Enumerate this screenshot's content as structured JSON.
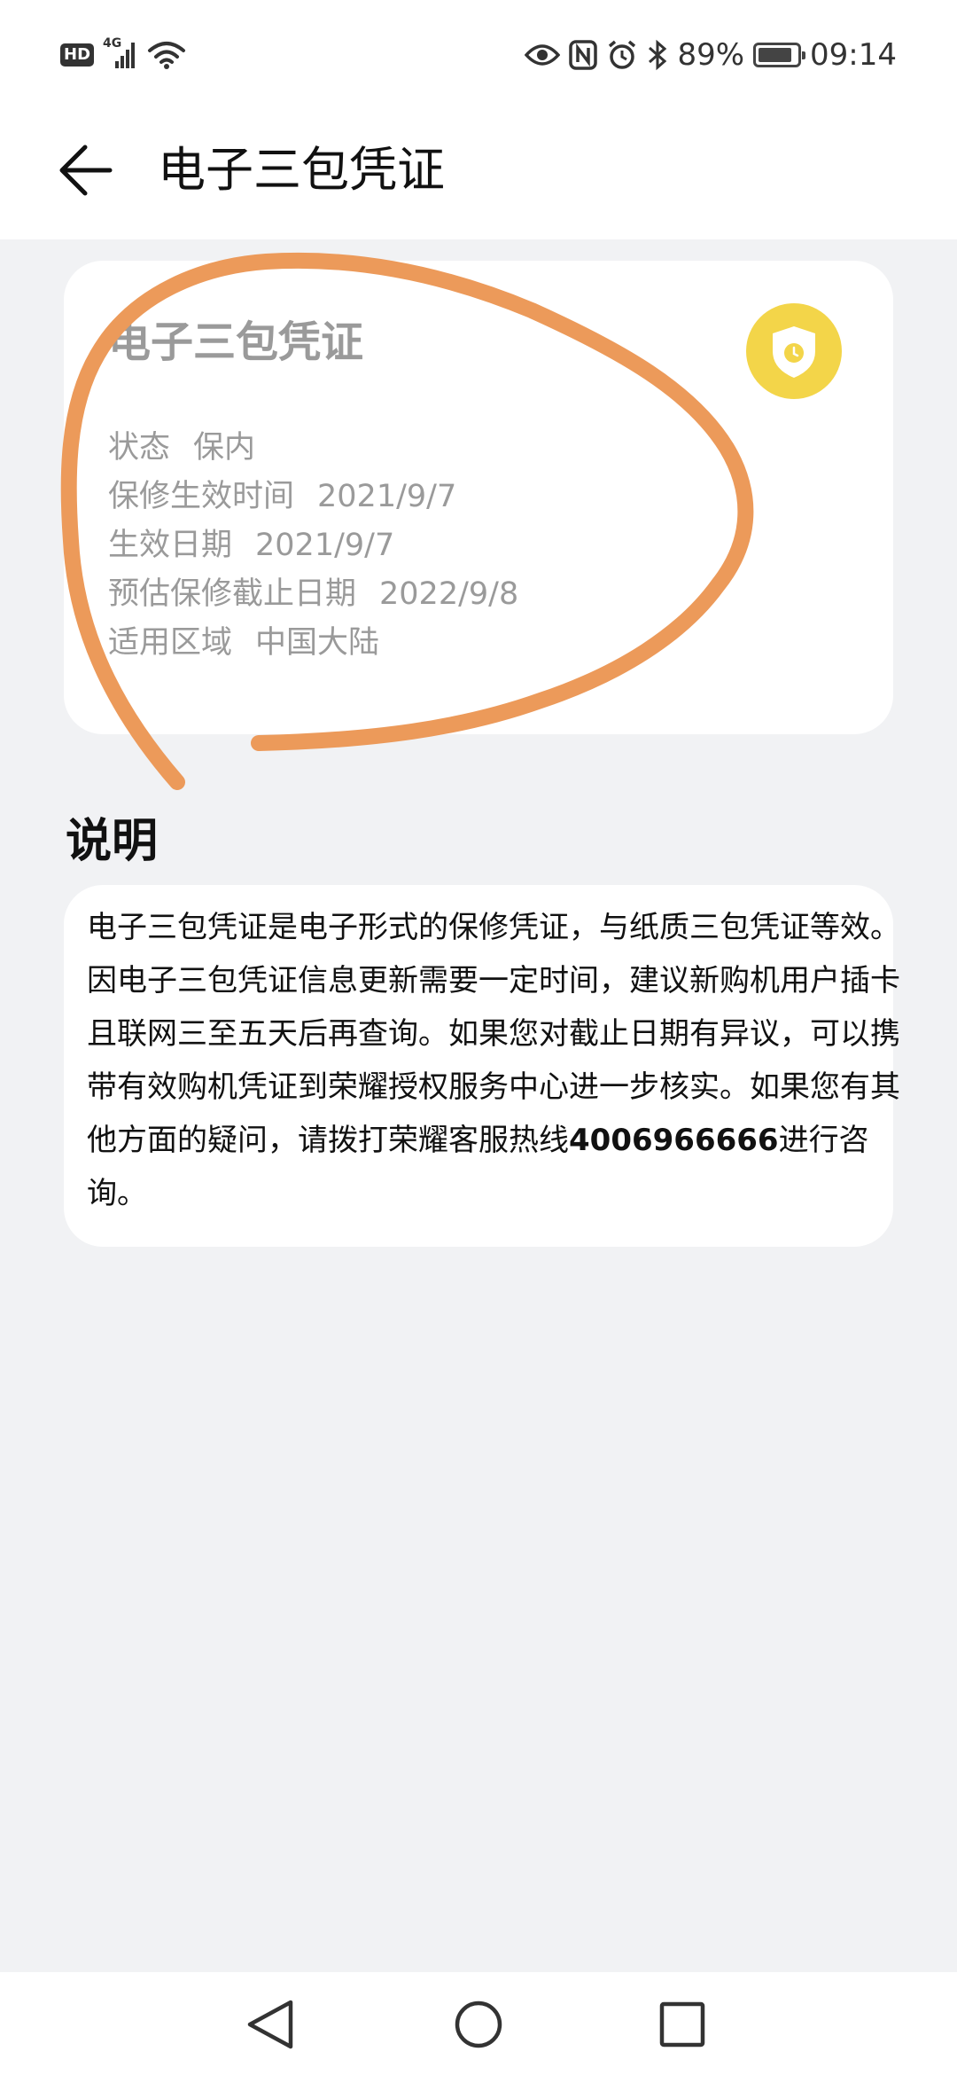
{
  "status_bar": {
    "hd_badge": "HD",
    "network": "4G",
    "battery_percent": "89%",
    "battery_level": 0.89,
    "time": "09:14",
    "icons": [
      "signal-icon",
      "wifi-icon",
      "eye-icon",
      "nfc-icon",
      "alarm-icon",
      "bluetooth-icon",
      "battery-icon"
    ]
  },
  "header": {
    "title": "电子三包凭证"
  },
  "warranty_card": {
    "title": "电子三包凭证",
    "badge_icon": "shield-clock-icon",
    "badge_color": "#f3d549",
    "fields": [
      {
        "label": "状态",
        "value": "保内"
      },
      {
        "label": "保修生效时间",
        "value": "2021/9/7"
      },
      {
        "label": "生效日期",
        "value": "2021/9/7"
      },
      {
        "label": "预估保修截止日期",
        "value": "2022/9/8"
      },
      {
        "label": "适用区域",
        "value": "中国大陆"
      }
    ]
  },
  "description": {
    "heading": "说明",
    "text_before": "电子三包凭证是电子形式的保修凭证，与纸质三包凭证等效。因电子三包凭证信息更新需要一定时间，建议新购机用户插卡且联网三至五天后再查询。如果您对截止日期有异议，可以携带有效购机凭证到荣耀授权服务中心进一步核实。如果您有其他方面的疑问，请拨打荣耀客服热线",
    "hotline": "4006966666",
    "text_after": "进行咨询。"
  },
  "annotation_color": "#ec9a5a",
  "nav_bar": {
    "icons": [
      "back-triangle-icon",
      "home-circle-icon",
      "recents-square-icon"
    ]
  }
}
